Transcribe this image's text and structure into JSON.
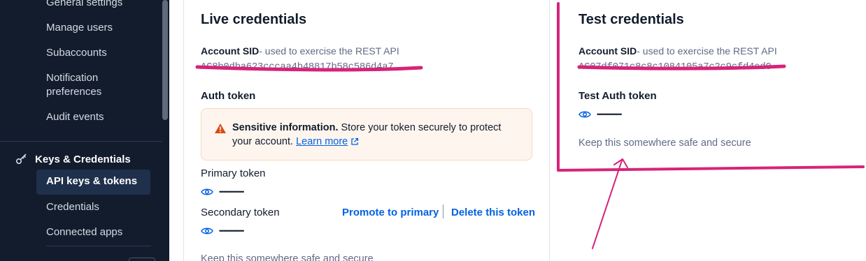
{
  "sidebar": {
    "items_top": [
      {
        "label": "General settings"
      },
      {
        "label": "Manage users"
      },
      {
        "label": "Subaccounts"
      },
      {
        "label": "Notification preferences"
      },
      {
        "label": "Audit events"
      }
    ],
    "section_title": "Keys & Credentials",
    "section_icon": "key-icon",
    "active_item": "API keys & tokens",
    "items_bottom": [
      {
        "label": "Credentials"
      },
      {
        "label": "Connected apps"
      }
    ]
  },
  "live": {
    "title": "Live credentials",
    "account_sid_label": "Account SID",
    "account_sid_hint": "- used to exercise the REST API",
    "account_sid_value": "AC8b0dba623cccaa4b48817b58c586d4a7",
    "auth_token_label": "Auth token",
    "alert": {
      "title": "Sensitive information.",
      "body": "Store your token securely to protect your account.",
      "link": "Learn more",
      "icon": "warning-icon"
    },
    "primary_token_label": "Primary token",
    "primary_token_mask": "••••••••••••••••••",
    "secondary_token_label": "Secondary token",
    "secondary_token_mask": "••••••••••••••••••",
    "promote_label": "Promote to primary",
    "delete_label": "Delete this token",
    "help": "Keep this somewhere safe and secure"
  },
  "test": {
    "title": "Test credentials",
    "account_sid_label": "Account SID",
    "account_sid_hint": "- used to exercise the REST API",
    "account_sid_value": "AC07df071c8c8c1084105a7c2c9cfd4cd0",
    "auth_token_label": "Test Auth token",
    "token_mask": "••••••••••••••••••",
    "help": "Keep this somewhere safe and secure"
  },
  "colors": {
    "sidebar_bg": "#121c2d",
    "link": "#0263e0",
    "annotation": "#d6237a",
    "alert_bg": "#fef5ee",
    "warning": "#d64d13"
  }
}
